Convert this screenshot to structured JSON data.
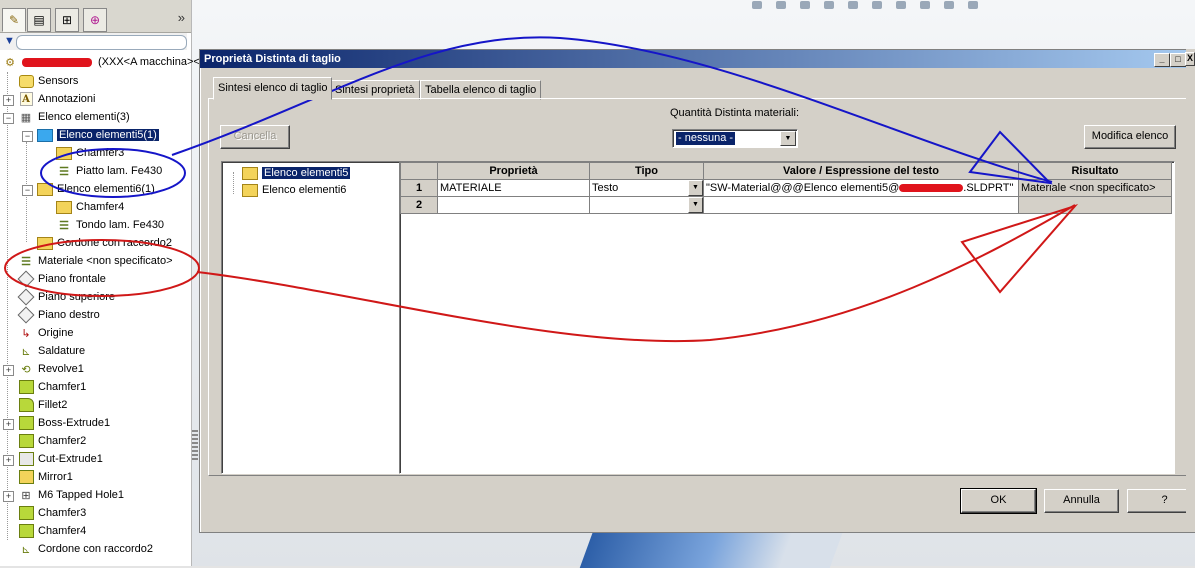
{
  "feature_manager": {
    "expand_symbol": "»",
    "root_label": "(XXX<A macchina><",
    "items": [
      {
        "label": "Sensors"
      },
      {
        "label": "Annotazioni"
      },
      {
        "label": "Elenco elementi(3)"
      },
      {
        "label": "Elenco elementi5(1)"
      },
      {
        "label": "Chamfer3"
      },
      {
        "label": "Piatto lam. Fe430"
      },
      {
        "label": "Elenco elementi6(1)"
      },
      {
        "label": "Chamfer4"
      },
      {
        "label": "Tondo lam. Fe430"
      },
      {
        "label": "Cordone con raccordo2"
      },
      {
        "label": "Materiale <non specificato>"
      },
      {
        "label": "Piano frontale"
      },
      {
        "label": "Piano superiore"
      },
      {
        "label": "Piano destro"
      },
      {
        "label": "Origine"
      },
      {
        "label": "Saldature"
      },
      {
        "label": "Revolve1"
      },
      {
        "label": "Chamfer1"
      },
      {
        "label": "Fillet2"
      },
      {
        "label": "Boss-Extrude1"
      },
      {
        "label": "Chamfer2"
      },
      {
        "label": "Cut-Extrude1"
      },
      {
        "label": "Mirror1"
      },
      {
        "label": "M6 Tapped Hole1"
      },
      {
        "label": "Chamfer3"
      },
      {
        "label": "Chamfer4"
      },
      {
        "label": "Cordone con raccordo2"
      }
    ]
  },
  "dialog": {
    "title": "Proprietà Distinta di taglio",
    "tabs": [
      "Sintesi elenco di taglio",
      "Sintesi proprietà",
      "Tabella elenco di taglio"
    ],
    "cancel_button": "Cancella",
    "quantity_label": "Quantità Distinta materiali:",
    "quantity_value": "- nessuna -",
    "modify_button": "Modifica elenco",
    "left_list": [
      "Elenco elementi5",
      "Elenco elementi6"
    ],
    "grid": {
      "headers": [
        "Proprietà",
        "Tipo",
        "Valore / Espressione del testo",
        "Risultato"
      ],
      "rows": [
        {
          "num": "1",
          "property": "MATERIALE",
          "type": "Testo",
          "value_prefix": "\"SW-Material@@@Elenco elementi5@",
          "value_suffix": ".SLDPRT\"",
          "result": "Materiale <non specificato>"
        },
        {
          "num": "2",
          "property": "",
          "type": "",
          "value_prefix": "",
          "value_suffix": "",
          "result": ""
        }
      ]
    },
    "ok_button": "OK",
    "cancel_dialog_button": "Annulla",
    "help_button": "?"
  },
  "colors": {
    "annotation_blue": "#1515c8",
    "annotation_red": "#d01818",
    "redaction": "#e0141c",
    "selection": "#0a246a"
  }
}
